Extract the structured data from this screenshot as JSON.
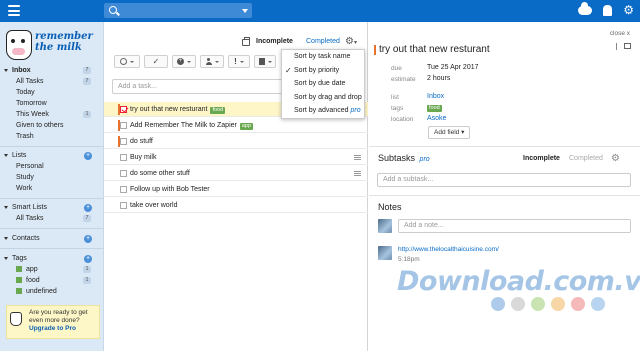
{
  "topbar": {
    "search_placeholder": ""
  },
  "logo": {
    "line1": "remember",
    "line2": "the milk"
  },
  "sidebar": {
    "inbox_section": {
      "label": "Inbox",
      "count": "7"
    },
    "inbox_items": [
      {
        "label": "All Tasks",
        "count": "7"
      },
      {
        "label": "Today",
        "count": ""
      },
      {
        "label": "Tomorrow",
        "count": ""
      },
      {
        "label": "This Week",
        "count": "1"
      },
      {
        "label": "Given to others",
        "count": ""
      },
      {
        "label": "Trash",
        "count": ""
      }
    ],
    "lists_section": {
      "label": "Lists"
    },
    "lists_items": [
      {
        "label": "Personal"
      },
      {
        "label": "Study"
      },
      {
        "label": "Work"
      }
    ],
    "smart_section": {
      "label": "Smart Lists"
    },
    "smart_items": [
      {
        "label": "All Tasks",
        "count": "7"
      }
    ],
    "contacts_section": {
      "label": "Contacts"
    },
    "tags_section": {
      "label": "Tags"
    },
    "tag_items": [
      {
        "label": "app",
        "count": "1"
      },
      {
        "label": "food",
        "count": "1"
      },
      {
        "label": "undefined",
        "count": ""
      }
    ],
    "promo": {
      "text1": "Are you ready to get",
      "text2": "even more done?",
      "link": "Upgrade to Pro"
    }
  },
  "tasklist": {
    "seg_incomplete": "Incomplete",
    "seg_completed": "Completed",
    "add_placeholder": "Add a task...",
    "tasks": [
      {
        "name": "try out that new resturant",
        "tag": "food"
      },
      {
        "name": "Add Remember The Milk to Zapier",
        "tag": "app"
      },
      {
        "name": "do stuff",
        "tag": ""
      },
      {
        "name": "Buy milk",
        "tag": ""
      },
      {
        "name": "do some other stuff",
        "tag": ""
      },
      {
        "name": "Follow up with Bob Tester",
        "tag": ""
      },
      {
        "name": "take over world",
        "tag": ""
      }
    ]
  },
  "sort_menu": {
    "items": [
      {
        "label": "Sort by task name",
        "checked": false
      },
      {
        "label": "Sort by priority",
        "checked": true
      },
      {
        "label": "Sort by due date",
        "checked": false
      },
      {
        "label": "Sort by drag and drop",
        "checked": false
      },
      {
        "label": "Sort by advanced",
        "checked": false,
        "pro": "pro"
      }
    ]
  },
  "detail": {
    "close": "close x",
    "title": "try out that new resturant",
    "fields": {
      "due_label": "due",
      "due_value": "Tue 25 Apr 2017",
      "estimate_label": "estimate",
      "estimate_value": "2 hours",
      "list_label": "list",
      "list_value": "Inbox",
      "tags_label": "tags",
      "tags_value": "food",
      "location_label": "location",
      "location_value": "Asoke"
    },
    "add_field": "Add field",
    "subtasks_title": "Subtasks",
    "subtasks_pro": "pro",
    "subtasks_incomplete": "Incomplete",
    "subtasks_completed": "Completed",
    "subtask_placeholder": "Add a subtask...",
    "notes_title": "Notes",
    "note_placeholder": "Add a note...",
    "note_link": "http://www.thelocalthaicuisine.com/",
    "note_time": "5:18pm"
  },
  "watermark": {
    "text": "Download.com.vn"
  },
  "colors": {
    "topbar": "#0a6bc6",
    "sidebar": "#dbe9f6",
    "tag_green": "#6aa84f",
    "priority_orange": "#e6722d",
    "selected_row": "#fff6c8"
  }
}
